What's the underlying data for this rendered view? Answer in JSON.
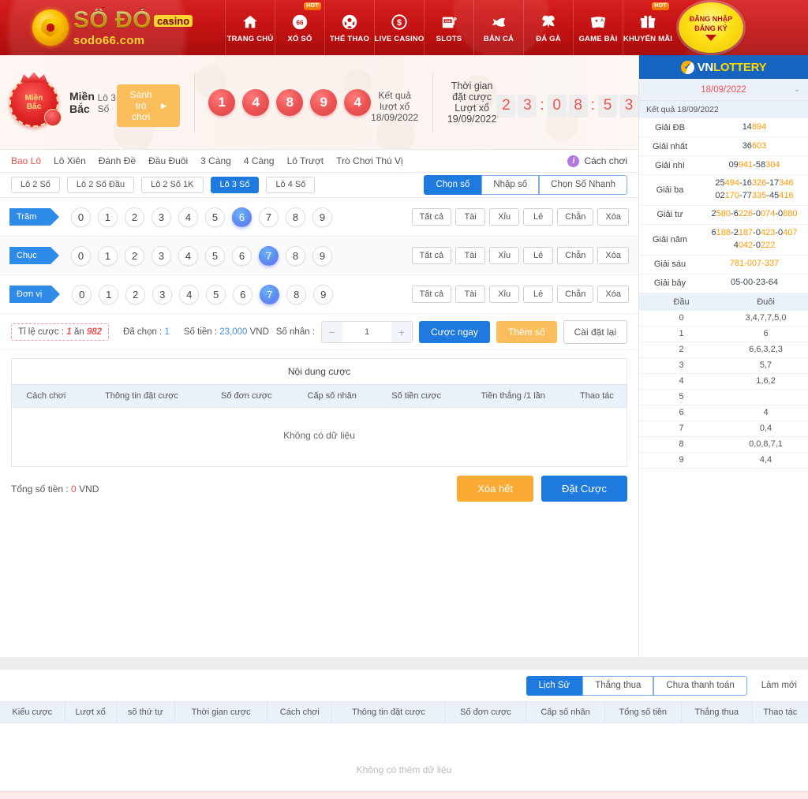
{
  "header": {
    "logo": {
      "main": "SỐ ĐỎ",
      "casino_tag": "casino",
      "sub": "sodo66.com"
    },
    "nav": [
      {
        "label": "TRANG CHỦ",
        "icon": "home-icon",
        "hot": false
      },
      {
        "label": "XỔ SỐ",
        "icon": "lottery-ball-icon",
        "hot": true,
        "hot_label": "HOT"
      },
      {
        "label": "THỂ THAO",
        "icon": "soccer-ball-icon",
        "hot": false
      },
      {
        "label": "LIVE CASINO",
        "icon": "dollar-coin-icon",
        "hot": false
      },
      {
        "label": "SLOTS",
        "icon": "slot-machine-icon",
        "hot": false
      },
      {
        "label": "BẮN CÁ",
        "icon": "fish-icon",
        "hot": false
      },
      {
        "label": "ĐÁ GÀ",
        "icon": "rooster-icon",
        "hot": false
      },
      {
        "label": "GAME BÀI",
        "icon": "playing-cards-icon",
        "hot": false
      },
      {
        "label": "KHUYẾN MÃI",
        "icon": "gift-icon",
        "hot": true,
        "hot_label": "HOT"
      }
    ],
    "login": {
      "line1": "ĐĂNG NHẬP",
      "line2": "ĐĂNG KÝ"
    }
  },
  "result_banner": {
    "badge_line1": "Miền",
    "badge_line2": "Bắc",
    "region": "Miền Bắc",
    "mode": "Lô 3 Số",
    "lobby_button": "Sành trò chơi",
    "balls": [
      "1",
      "4",
      "8",
      "9",
      "4"
    ],
    "balls_caption": "Kết quả lượt xổ 18/09/2022",
    "countdown_title": "Thời gian đặt cược Lượt xổ 19/09/2022",
    "countdown": [
      "2",
      "3",
      ":",
      "0",
      "8",
      ":",
      "5",
      "3"
    ]
  },
  "tabs": {
    "items": [
      {
        "label": "Bao Lô",
        "active": true
      },
      {
        "label": "Lô Xiên",
        "active": false
      },
      {
        "label": "Đánh Đề",
        "active": false
      },
      {
        "label": "Đầu Đuôi",
        "active": false
      },
      {
        "label": "3 Càng",
        "active": false
      },
      {
        "label": "4 Càng",
        "active": false
      },
      {
        "label": "Lô Trượt",
        "active": false
      },
      {
        "label": "Trò Chơi Thú Vị",
        "active": false
      }
    ],
    "howto": "Cách chơi"
  },
  "subtabs": {
    "items": [
      {
        "label": "Lô 2 Số",
        "active": false
      },
      {
        "label": "Lô 2 Số Đầu",
        "active": false
      },
      {
        "label": "Lô 2 Số 1K",
        "active": false
      },
      {
        "label": "Lô 3 Số",
        "active": true
      },
      {
        "label": "Lô 4 Số",
        "active": false
      }
    ],
    "modes": [
      {
        "label": "Chọn số",
        "active": true
      },
      {
        "label": "Nhập số",
        "active": false
      },
      {
        "label": "Chọn Số Nhanh",
        "active": false
      }
    ]
  },
  "digit_rows": [
    {
      "tag": "Trăm",
      "digits": [
        "0",
        "1",
        "2",
        "3",
        "4",
        "5",
        "6",
        "7",
        "8",
        "9"
      ],
      "selected": "6",
      "actions": [
        "Tất cả",
        "Tài",
        "Xỉu",
        "Lẻ",
        "Chẵn",
        "Xóa"
      ]
    },
    {
      "tag": "Chục",
      "digits": [
        "0",
        "1",
        "2",
        "3",
        "4",
        "5",
        "6",
        "7",
        "8",
        "9"
      ],
      "selected": "7",
      "actions": [
        "Tất cả",
        "Tài",
        "Xỉu",
        "Lẻ",
        "Chẵn",
        "Xóa"
      ]
    },
    {
      "tag": "Đơn vị",
      "digits": [
        "0",
        "1",
        "2",
        "3",
        "4",
        "5",
        "6",
        "7",
        "8",
        "9"
      ],
      "selected": "7",
      "actions": [
        "Tất cả",
        "Tài",
        "Xỉu",
        "Lẻ",
        "Chẵn",
        "Xóa"
      ]
    }
  ],
  "bet_summary": {
    "odds_prefix": "Tỉ lệ cược : ",
    "odds_one": "1",
    "odds_mid": " ăn ",
    "odds_value": "982",
    "chosen_label": "Đã chọn : ",
    "chosen_value": "1",
    "amount_label": "Số tiền : ",
    "amount_value": "23,000",
    "amount_unit": " VND",
    "multiplier_label": "Số nhân :",
    "multiplier_value": "1",
    "minus": "−",
    "plus": "+",
    "bet_now": "Cược ngay",
    "add_number": "Thêm số",
    "reset": "Cài đặt lại"
  },
  "bet_panel": {
    "title": "Nội dung cược",
    "columns": [
      "Cách chơi",
      "Thông tin đặt cược",
      "Số đơn cược",
      "Cấp số nhân",
      "Số tiền cược",
      "Tiền thắng /1 lần",
      "Thao tác"
    ],
    "empty": "Không có dữ liệu",
    "total_label": "Tổng số tiền : ",
    "total_value": "0",
    "total_unit": " VND",
    "clear_all": "Xóa hết",
    "place_bet": "Đặt Cược"
  },
  "sidebar": {
    "brand_w": "VN",
    "brand_y": "LOTTERY",
    "date": "18/09/2022",
    "results_header": "Kết quả 18/09/2022",
    "prizes": [
      {
        "label": "Giải ĐB",
        "lines": [
          [
            {
              "t": "14",
              "c": "dk"
            },
            {
              "t": "894",
              "c": "og"
            }
          ]
        ]
      },
      {
        "label": "Giải nhất",
        "lines": [
          [
            {
              "t": "36",
              "c": "dk"
            },
            {
              "t": "603",
              "c": "og"
            }
          ]
        ]
      },
      {
        "label": "Giải nhì",
        "lines": [
          [
            {
              "t": "09",
              "c": "dk"
            },
            {
              "t": "941",
              "c": "og"
            },
            {
              "t": "-58",
              "c": "dk"
            },
            {
              "t": "304",
              "c": "og"
            }
          ]
        ]
      },
      {
        "label": "Giải ba",
        "lines": [
          [
            {
              "t": "25",
              "c": "dk"
            },
            {
              "t": "494",
              "c": "og"
            },
            {
              "t": "-16",
              "c": "dk"
            },
            {
              "t": "326",
              "c": "og"
            },
            {
              "t": "-17",
              "c": "dk"
            },
            {
              "t": "346",
              "c": "og"
            }
          ],
          [
            {
              "t": "02",
              "c": "dk"
            },
            {
              "t": "170",
              "c": "og"
            },
            {
              "t": "-77",
              "c": "dk"
            },
            {
              "t": "335",
              "c": "og"
            },
            {
              "t": "-45",
              "c": "dk"
            },
            {
              "t": "416",
              "c": "og"
            }
          ]
        ]
      },
      {
        "label": "Giải tư",
        "lines": [
          [
            {
              "t": "2",
              "c": "dk"
            },
            {
              "t": "580",
              "c": "og"
            },
            {
              "t": "-6",
              "c": "dk"
            },
            {
              "t": "226",
              "c": "og"
            },
            {
              "t": "-0",
              "c": "dk"
            },
            {
              "t": "074",
              "c": "og"
            },
            {
              "t": "-0",
              "c": "dk"
            },
            {
              "t": "880",
              "c": "og"
            }
          ]
        ]
      },
      {
        "label": "Giải năm",
        "lines": [
          [
            {
              "t": "6",
              "c": "dk"
            },
            {
              "t": "188",
              "c": "og"
            },
            {
              "t": "-2",
              "c": "dk"
            },
            {
              "t": "187",
              "c": "og"
            },
            {
              "t": "-0",
              "c": "dk"
            },
            {
              "t": "423",
              "c": "og"
            },
            {
              "t": "-0",
              "c": "dk"
            },
            {
              "t": "407",
              "c": "og"
            }
          ],
          [
            {
              "t": "4",
              "c": "dk"
            },
            {
              "t": "042",
              "c": "og"
            },
            {
              "t": "-0",
              "c": "dk"
            },
            {
              "t": "222",
              "c": "og"
            }
          ]
        ]
      },
      {
        "label": "Giải sáu",
        "lines": [
          [
            {
              "t": "781-007-337",
              "c": "og"
            }
          ]
        ]
      },
      {
        "label": "Giải bảy",
        "lines": [
          [
            {
              "t": "05-00-23-64",
              "c": "dk"
            }
          ]
        ]
      }
    ],
    "dd_headers": [
      "Đầu",
      "Đuôi"
    ],
    "dd_rows": [
      {
        "dau": "0",
        "duoi": "3,4,7,7,5,0"
      },
      {
        "dau": "1",
        "duoi": "6"
      },
      {
        "dau": "2",
        "duoi": "6,6,3,2,3"
      },
      {
        "dau": "3",
        "duoi": "5,7"
      },
      {
        "dau": "4",
        "duoi": "1,6,2"
      },
      {
        "dau": "5",
        "duoi": ""
      },
      {
        "dau": "6",
        "duoi": "4"
      },
      {
        "dau": "7",
        "duoi": "0,4"
      },
      {
        "dau": "8",
        "duoi": "0,0,8,7,1"
      },
      {
        "dau": "9",
        "duoi": "4,4"
      }
    ]
  },
  "history": {
    "tabs": [
      {
        "label": "Lịch Sử",
        "active": true
      },
      {
        "label": "Thắng thua",
        "active": false
      },
      {
        "label": "Chưa thanh toán",
        "active": false
      }
    ],
    "refresh": "Làm mới",
    "columns": [
      "Kiểu cược",
      "Lượt xổ",
      "số thứ tự",
      "Thời gian cược",
      "Cách chơi",
      "Thông tin đặt cược",
      "Số đơn cược",
      "Cấp số nhân",
      "Tổng số tiền",
      "Thắng thua",
      "Thao tác"
    ],
    "empty": "Không có thêm dữ liệu"
  }
}
